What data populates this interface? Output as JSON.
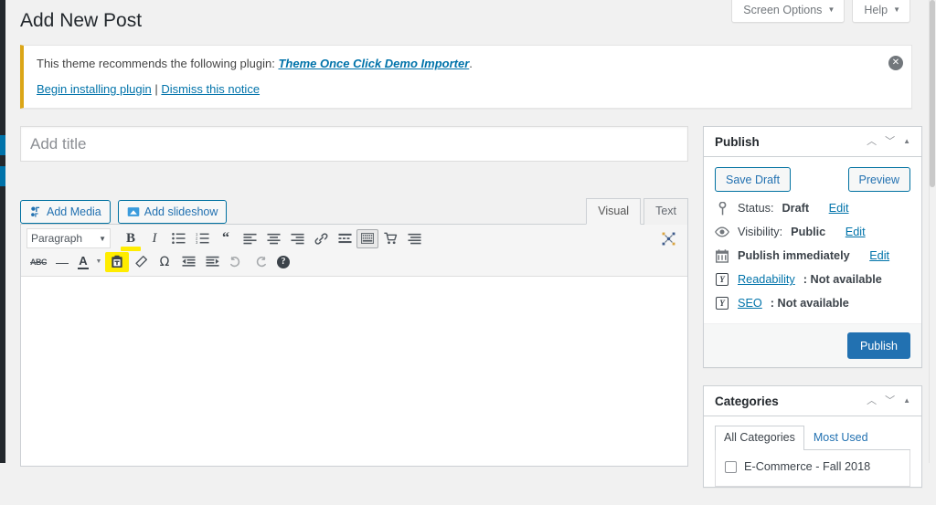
{
  "screen_meta": {
    "screen_options_label": "Screen Options",
    "help_label": "Help",
    "caret": "▼"
  },
  "page": {
    "title": "Add New Post"
  },
  "notice": {
    "text_before": "This theme recommends the following plugin: ",
    "plugin_link": "Theme Once Click Demo Importer",
    "text_after": ".",
    "begin_install_link": "Begin installing plugin",
    "separator": "|",
    "dismiss_link": "Dismiss this notice",
    "close_glyph": "✕"
  },
  "post_title": {
    "value": "",
    "placeholder": "Add title"
  },
  "media": {
    "add_media_label": "Add Media",
    "add_slideshow_label": "Add slideshow"
  },
  "editor_tabs": {
    "visual": "Visual",
    "text": "Text"
  },
  "toolbar": {
    "format_select_value": "Paragraph",
    "format_caret": "▼",
    "row1": [
      {
        "name": "bold-icon",
        "glyph": "B",
        "style": "bold",
        "highlight_under": true
      },
      {
        "name": "italic-icon",
        "glyph": "I",
        "style": "italic"
      },
      {
        "name": "bulleted-list-icon",
        "glyph": "list-ul"
      },
      {
        "name": "numbered-list-icon",
        "glyph": "list-ol"
      },
      {
        "name": "blockquote-icon",
        "glyph": "“"
      },
      {
        "name": "align-left-icon",
        "glyph": "align-left"
      },
      {
        "name": "align-center-icon",
        "glyph": "align-center"
      },
      {
        "name": "align-right-icon",
        "glyph": "align-right"
      },
      {
        "name": "insert-link-icon",
        "glyph": "link"
      },
      {
        "name": "read-more-icon",
        "glyph": "more"
      },
      {
        "name": "toolbar-toggle-icon",
        "glyph": "kitchen-sink",
        "active": true
      },
      {
        "name": "add-to-cart-icon",
        "glyph": "cart"
      },
      {
        "name": "align-justify-icon",
        "glyph": "justify"
      }
    ],
    "row2": [
      {
        "name": "strikethrough-icon",
        "glyph": "ABC"
      },
      {
        "name": "horizontal-rule-icon",
        "glyph": "—"
      },
      {
        "name": "text-color-icon",
        "glyph": "A"
      },
      {
        "name": "text-color-dropdown-icon",
        "glyph": "▼"
      },
      {
        "name": "paste-as-text-icon",
        "glyph": "clipboard",
        "highlighted": true
      },
      {
        "name": "clear-formatting-icon",
        "glyph": "eraser"
      },
      {
        "name": "special-character-icon",
        "glyph": "Ω"
      },
      {
        "name": "decrease-indent-icon",
        "glyph": "outdent"
      },
      {
        "name": "increase-indent-icon",
        "glyph": "indent"
      },
      {
        "name": "undo-icon",
        "glyph": "↺"
      },
      {
        "name": "redo-icon",
        "glyph": "↻"
      },
      {
        "name": "keyboard-shortcuts-icon",
        "glyph": "?"
      }
    ],
    "fullscreen_icon": "distraction-free-icon"
  },
  "publish_panel": {
    "title": "Publish",
    "up_chevron": "︿",
    "down_chevron": "﹀",
    "collapse_triangle": "▲",
    "save_draft_label": "Save Draft",
    "preview_label": "Preview",
    "rows": [
      {
        "icon": "pin-icon",
        "label": "Status: ",
        "value": "Draft",
        "action": "Edit"
      },
      {
        "icon": "eye-icon",
        "label": "Visibility: ",
        "value": "Public",
        "action": "Edit"
      },
      {
        "icon": "calendar-icon",
        "label": "Publish immediately",
        "value": "",
        "action": "Edit"
      },
      {
        "icon": "yoast-icon",
        "label": "Readability",
        "value": ": Not available",
        "action": ""
      },
      {
        "icon": "yoast-icon",
        "label": "SEO",
        "value": ": Not available",
        "action": ""
      }
    ],
    "publish_button_label": "Publish"
  },
  "categories_panel": {
    "title": "Categories",
    "up_chevron": "︿",
    "down_chevron": "﹀",
    "collapse_triangle": "▲",
    "tabs": [
      {
        "label": "All Categories",
        "active": true
      },
      {
        "label": "Most Used",
        "active": false
      }
    ],
    "items": [
      {
        "label": "E-Commerce - Fall 2018",
        "checked": false
      }
    ]
  },
  "colors": {
    "wp_blue": "#2271b1",
    "link_blue": "#0073aa",
    "admin_dark": "#23282d",
    "notice_accent": "#dba617",
    "highlight_yellow": "#ffec00",
    "page_bg": "#f1f1f1"
  }
}
